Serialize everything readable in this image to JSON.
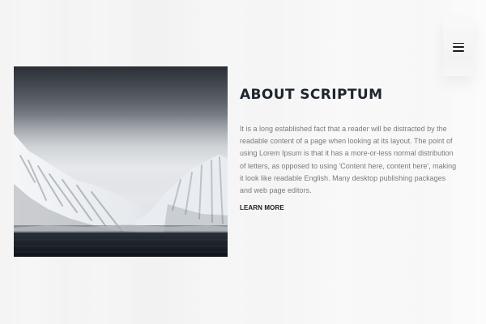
{
  "header": {
    "menu_icon": "hamburger-menu-icon"
  },
  "about": {
    "title": "ABOUT SCRIPTUM",
    "body": "It is a long established fact that a reader will be distracted by the readable content of a page when looking at its layout. The point of using Lorem Ipsum is that it has a more-or-less normal distribution of letters, as opposed to using 'Content here, content here', making it look like readable English. Many desktop publishing packages and web page editors.",
    "cta_label": "LEARN MORE"
  },
  "image": {
    "subject": "snowy-mountains-over-water"
  },
  "colors": {
    "background": "#f6f6f6",
    "title": "#1f252d",
    "body_text": "#7b7b7b",
    "link": "#1d1d1d",
    "menu_panel": "#f5f5f5"
  }
}
